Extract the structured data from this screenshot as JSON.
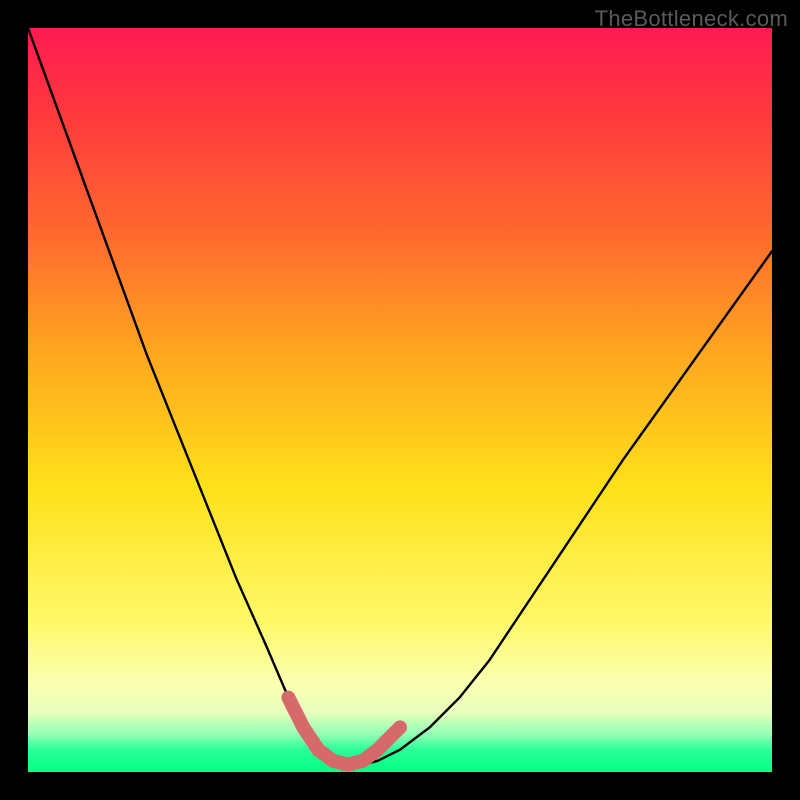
{
  "watermark": "TheBottleneck.com",
  "chart_data": {
    "type": "line",
    "title": "",
    "xlabel": "",
    "ylabel": "",
    "xlim": [
      0,
      100
    ],
    "ylim": [
      0,
      100
    ],
    "series": [
      {
        "name": "bottleneck-curve",
        "x": [
          0,
          4,
          8,
          12,
          16,
          20,
          24,
          28,
          32,
          35,
          37,
          39,
          41,
          43,
          45,
          47,
          50,
          54,
          58,
          62,
          66,
          72,
          80,
          90,
          100
        ],
        "y": [
          100,
          89,
          78,
          67,
          56,
          46,
          36,
          26,
          17,
          10,
          6,
          3,
          1.5,
          1,
          1,
          1.5,
          3,
          6,
          10,
          15,
          21,
          30,
          42,
          56,
          70
        ]
      },
      {
        "name": "optimal-range-highlight",
        "x": [
          35,
          37,
          39,
          41,
          43,
          45,
          47,
          50
        ],
        "y": [
          10,
          6,
          3,
          1.5,
          1,
          1.5,
          3,
          6
        ]
      }
    ],
    "gradient_colors": {
      "top": "#ff1a52",
      "mid": "#ffe11a",
      "bottom": "#08ff84"
    }
  }
}
